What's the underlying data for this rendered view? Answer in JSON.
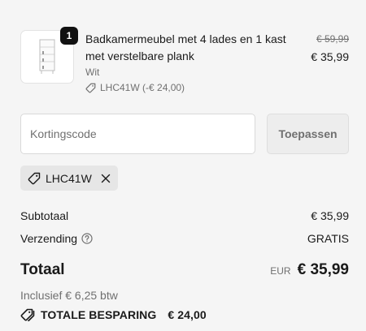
{
  "line_item": {
    "quantity_badge": "1",
    "title": "Badkamermeubel met 4 lades en 1 kast met verstelbare plank",
    "variant": "Wit",
    "discount_applied": "LHC41W (-€ 24,00)",
    "original_price": "€ 59,99",
    "price": "€ 35,99",
    "image_icon": "cabinet-thumbnail"
  },
  "discount": {
    "placeholder": "Kortingscode",
    "value": "",
    "apply_label": "Toepassen",
    "applied_code": "LHC41W"
  },
  "summary": {
    "subtotal_label": "Subtotaal",
    "subtotal_value": "€ 35,99",
    "shipping_label": "Verzending",
    "shipping_value": "GRATIS",
    "total_label": "Totaal",
    "currency": "EUR",
    "total_value": "€ 35,99",
    "tax_note": "Inclusief € 6,25 btw",
    "savings_label": "TOTALE BESPARING",
    "savings_value": "€ 24,00"
  },
  "colors": {
    "background": "#f5f5f5",
    "text": "#1a1a1a",
    "muted": "#707070",
    "badge": "#111111"
  }
}
